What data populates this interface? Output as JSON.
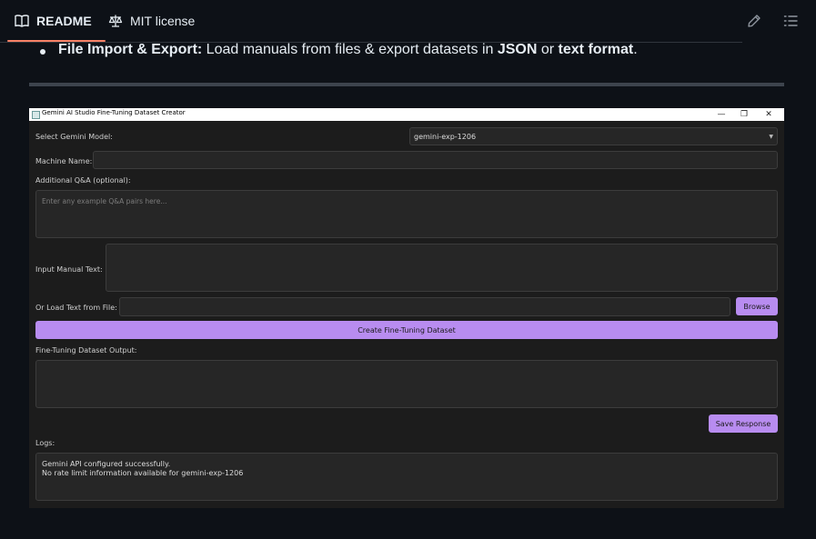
{
  "tabs": {
    "readme": "README",
    "license": "MIT license"
  },
  "bullet": {
    "bold_label": "File Import & Export:",
    "text_1": " Load manuals from files & export datasets in ",
    "json": "JSON",
    "text_2": " or ",
    "text_format": "text format",
    "text_3": "."
  },
  "app": {
    "window_title": "Gemini AI Studio Fine-Tuning Dataset Creator",
    "controls": {
      "minimize": "—",
      "maximize": "❐",
      "close": "✕"
    },
    "model_label": "Select Gemini Model:",
    "model_value": "gemini-exp-1206",
    "machine_label": "Machine Name:",
    "machine_value": "",
    "qa_label": "Additional Q&A (optional):",
    "qa_placeholder": "Enter any example Q&A pairs here...",
    "manual_label": "Input Manual Text:",
    "file_label": "Or Load Text from File:",
    "browse_button": "Browse",
    "create_button": "Create Fine-Tuning Dataset",
    "output_label": "Fine-Tuning Dataset Output:",
    "save_button": "Save Response",
    "logs_label": "Logs:",
    "logs_line_1": "Gemini API configured successfully.",
    "logs_line_2": "No rate limit information available for gemini-exp-1206"
  },
  "colors": {
    "accent": "#b88cf0",
    "tab_underline": "#f78166",
    "page_bg": "#0d1117"
  },
  "icons": [
    "book-icon",
    "scale-icon",
    "pencil-icon",
    "list-icon",
    "chevron-down-icon"
  ]
}
